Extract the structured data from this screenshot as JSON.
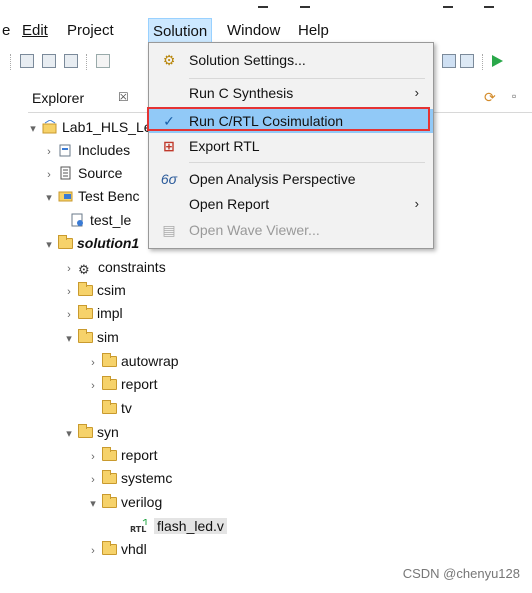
{
  "menubar": {
    "partial_left": "e",
    "edit": "Edit",
    "project": "Project",
    "solution": "Solution",
    "window": "Window",
    "help": "Help"
  },
  "explorer": {
    "tab_label": "Explorer",
    "tab_close": "☒"
  },
  "tree": {
    "project": "Lab1_HLS_Le",
    "includes": "Includes",
    "source": "Source",
    "test_bench": "Test Benc",
    "test_file": "test_le",
    "solution1": "solution1",
    "constraints": "constraints",
    "csim": "csim",
    "impl": "impl",
    "sim": "sim",
    "autowrap": "autowrap",
    "report": "report",
    "tv": "tv",
    "syn": "syn",
    "syn_report": "report",
    "systemc": "systemc",
    "verilog": "verilog",
    "flash_led": "flash_led.v",
    "vhdl": "vhdl",
    "rtl_badge": "RTL"
  },
  "solution_menu": {
    "settings": "Solution Settings...",
    "run_csynth": "Run C Synthesis",
    "run_cosim": "Run C/RTL Cosimulation",
    "export_rtl": "Export RTL",
    "open_analysis": "Open Analysis Perspective",
    "open_report": "Open Report",
    "open_wave": "Open Wave Viewer...",
    "submenu_arrow": "›",
    "check": "✓"
  },
  "watermark": "CSDN @chenyu128",
  "colors": {
    "menu_bg": "#f2f2f2",
    "highlight": "#91c9f7",
    "red_box": "#e53333",
    "folder": "#f6d26a"
  }
}
